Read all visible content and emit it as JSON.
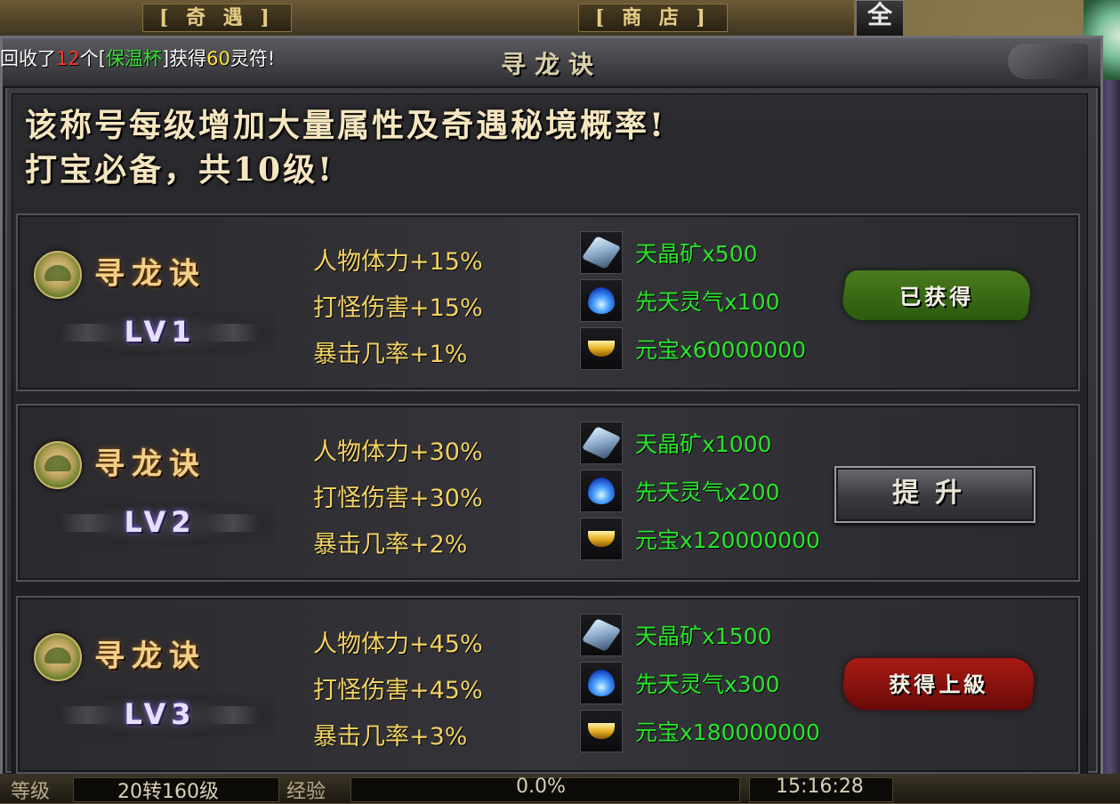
{
  "top_bar": {
    "tab_qiyu": "[ 奇 遇 ]",
    "tab_shop": "[ 商 店 ]",
    "quan_button": "全"
  },
  "system_message": {
    "prefix": "回收了",
    "count": "12",
    "unit": "个",
    "open": "[",
    "item": "保温杯",
    "close": "]",
    "verb": "获得",
    "amount": "60",
    "currency": "灵符!"
  },
  "dialog": {
    "title": "寻龙诀",
    "headline_line1": "该称号每级增加大量属性及奇遇秘境概率!",
    "headline_line2": "打宝必备，共10级!"
  },
  "tiers": [
    {
      "name": "寻龙诀",
      "level": "LV1",
      "stats": [
        "人物体力+15%",
        "打怪伤害+15%",
        "暴击几率+1%"
      ],
      "rewards": [
        "天晶矿x500",
        "先天灵气x100",
        "元宝x60000000"
      ],
      "status": "已获得"
    },
    {
      "name": "寻龙诀",
      "level": "LV2",
      "stats": [
        "人物体力+30%",
        "打怪伤害+30%",
        "暴击几率+2%"
      ],
      "rewards": [
        "天晶矿x1000",
        "先天灵气x200",
        "元宝x120000000"
      ],
      "action": "提升"
    },
    {
      "name": "寻龙诀",
      "level": "LV3",
      "stats": [
        "人物体力+45%",
        "打怪伤害+45%",
        "暴击几率+3%"
      ],
      "rewards": [
        "天晶矿x1500",
        "先天灵气x300",
        "元宝x180000000"
      ],
      "status": "获得上級"
    }
  ],
  "reward_icons": [
    "crystal-ore-icon",
    "blue-flame-icon",
    "gold-ingot-icon"
  ],
  "status_bar": {
    "level_label": "等级",
    "level_value": "20转160级",
    "exp_label": "经验",
    "exp_value": "0.0%",
    "time": "15:16:28"
  },
  "colors": {
    "stat_text": "#f2d262",
    "reward_text": "#28e628",
    "obtained_badge": "#3c6a16",
    "next_badge": "#8e1410"
  }
}
